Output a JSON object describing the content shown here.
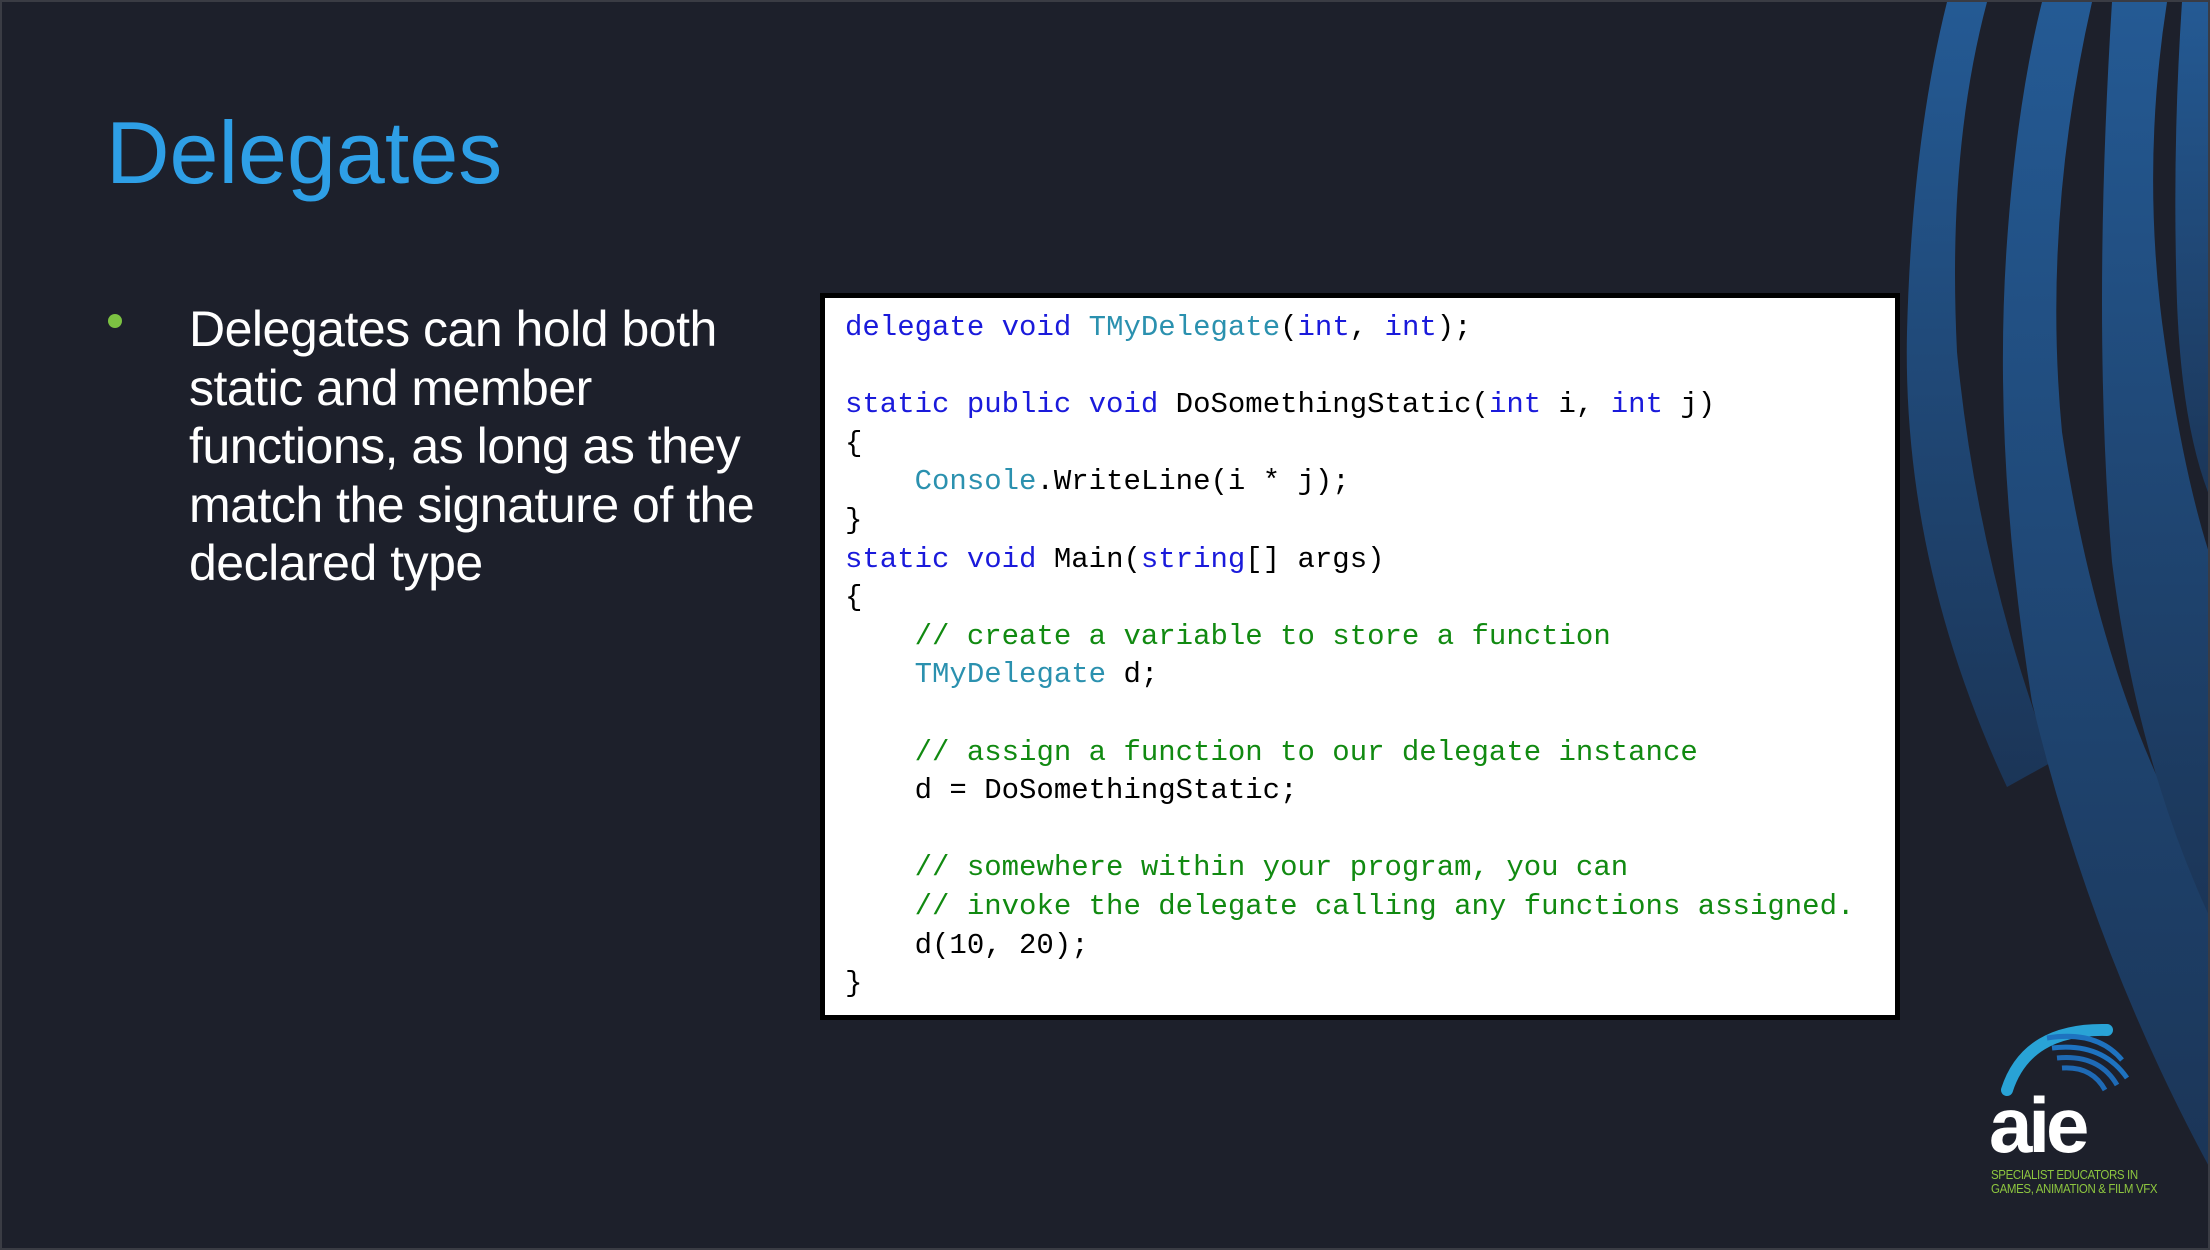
{
  "slide": {
    "title": "Delegates",
    "bullets": [
      "Delegates can hold both static and member functions, as long as they match the signature of the declared type"
    ],
    "colors": {
      "title": "#2e9fe6",
      "bullet": "#7cc242",
      "background": "#1d202b",
      "keyword": "#1a1adb",
      "type": "#2b91af",
      "comment": "#118a11"
    },
    "code_lines": [
      [
        [
          "delegate",
          "kw"
        ],
        [
          " ",
          "plain"
        ],
        [
          "void",
          "kw"
        ],
        [
          " ",
          "plain"
        ],
        [
          "TMyDelegate",
          "type"
        ],
        [
          "(",
          "plain"
        ],
        [
          "int",
          "kw"
        ],
        [
          ", ",
          "plain"
        ],
        [
          "int",
          "kw"
        ],
        [
          ");",
          "plain"
        ]
      ],
      [],
      [
        [
          "static",
          "kw"
        ],
        [
          " ",
          "plain"
        ],
        [
          "public",
          "kw"
        ],
        [
          " ",
          "plain"
        ],
        [
          "void",
          "kw"
        ],
        [
          " DoSomethingStatic(",
          "plain"
        ],
        [
          "int",
          "kw"
        ],
        [
          " i, ",
          "plain"
        ],
        [
          "int",
          "kw"
        ],
        [
          " j)",
          "plain"
        ]
      ],
      [
        [
          "{",
          "plain"
        ]
      ],
      [
        [
          "    ",
          "plain"
        ],
        [
          "Console",
          "type"
        ],
        [
          ".WriteLine(i * j);",
          "plain"
        ]
      ],
      [
        [
          "}",
          "plain"
        ]
      ],
      [
        [
          "static",
          "kw"
        ],
        [
          " ",
          "plain"
        ],
        [
          "void",
          "kw"
        ],
        [
          " Main(",
          "plain"
        ],
        [
          "string",
          "kw"
        ],
        [
          "[] args)",
          "plain"
        ]
      ],
      [
        [
          "{",
          "plain"
        ]
      ],
      [
        [
          "    ",
          "plain"
        ],
        [
          "// create a variable to store a function",
          "cm"
        ]
      ],
      [
        [
          "    ",
          "plain"
        ],
        [
          "TMyDelegate",
          "type"
        ],
        [
          " d;",
          "plain"
        ]
      ],
      [],
      [
        [
          "    ",
          "plain"
        ],
        [
          "// assign a function to our delegate instance",
          "cm"
        ]
      ],
      [
        [
          "    d = DoSomethingStatic;",
          "plain"
        ]
      ],
      [],
      [
        [
          "    ",
          "plain"
        ],
        [
          "// somewhere within your program, you can",
          "cm"
        ]
      ],
      [
        [
          "    ",
          "plain"
        ],
        [
          "// invoke the delegate calling any functions assigned.",
          "cm"
        ]
      ],
      [
        [
          "    d(10, 20);",
          "plain"
        ]
      ],
      [
        [
          "}",
          "plain"
        ]
      ]
    ]
  },
  "logo": {
    "word": "aie",
    "tagline": "SPECIALIST EDUCATORS IN\nGAMES, ANIMATION & FILM VFX"
  }
}
